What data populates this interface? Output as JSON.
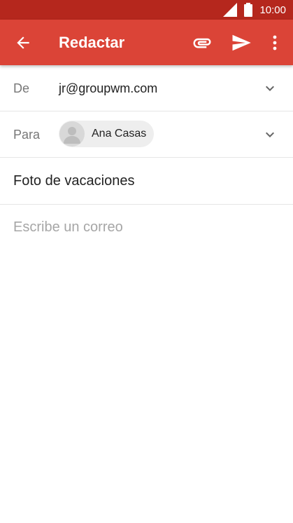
{
  "status_bar": {
    "time": "10:00"
  },
  "app_bar": {
    "title": "Redactar",
    "color": "#db4437",
    "status_color": "#b5271d",
    "icons": [
      "back-arrow-icon",
      "attach-icon",
      "send-icon",
      "more-vert-icon"
    ]
  },
  "compose": {
    "from_label": "De",
    "from_value": "jr@groupwm.com",
    "to_label": "Para",
    "to_recipient": "Ana Casas",
    "subject": "Foto de vacaciones",
    "body_placeholder": "Escribe un correo"
  }
}
